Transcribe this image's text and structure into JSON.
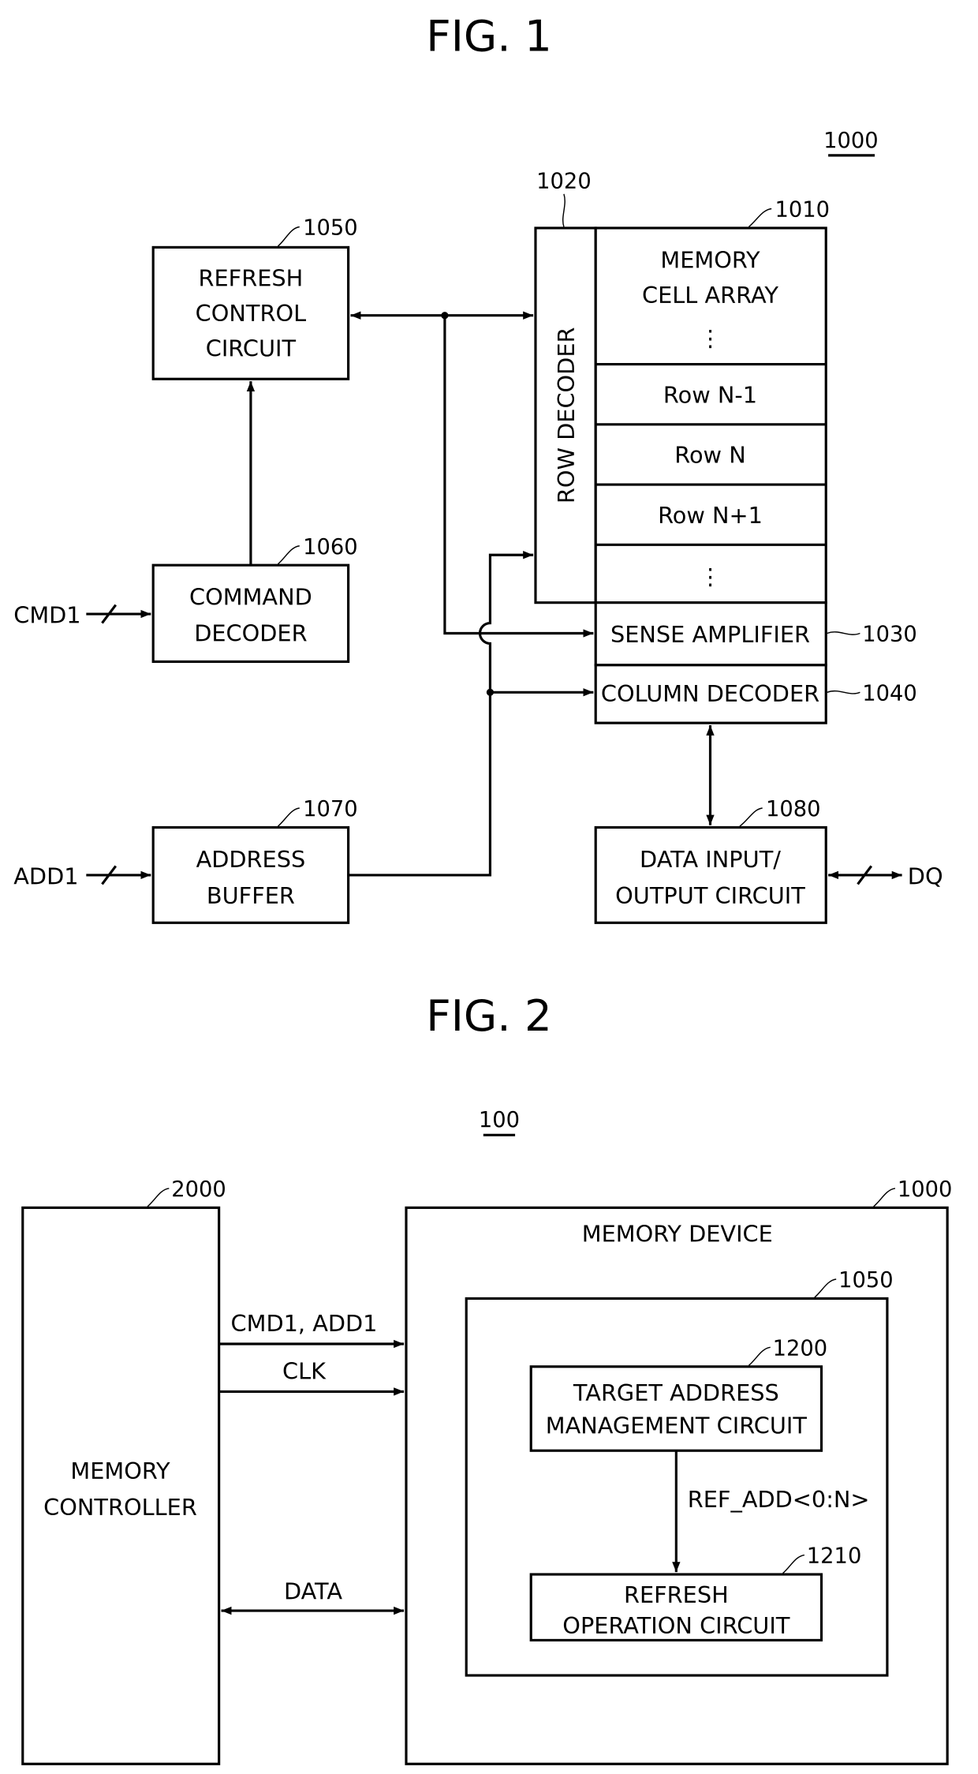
{
  "fig1": {
    "title": "FIG. 1",
    "device_ref": "1000",
    "blocks": {
      "refresh_control": {
        "lines": [
          "REFRESH",
          "CONTROL",
          "CIRCUIT"
        ],
        "ref": "1050"
      },
      "command_decoder": {
        "lines": [
          "COMMAND",
          "DECODER"
        ],
        "ref": "1060"
      },
      "address_buffer": {
        "lines": [
          "ADDRESS",
          "BUFFER"
        ],
        "ref": "1070"
      },
      "row_decoder": {
        "label": "ROW DECODER",
        "ref": "1020"
      },
      "memory_cell_array": {
        "lines": [
          "MEMORY",
          "CELL ARRAY"
        ],
        "ref": "1010",
        "rows": [
          "Row N-1",
          "Row N",
          "Row N+1"
        ],
        "ellipsis": "⋮"
      },
      "sense_amplifier": {
        "label": "SENSE AMPLIFIER",
        "ref": "1030"
      },
      "column_decoder": {
        "label": "COLUMN DECODER",
        "ref": "1040"
      },
      "data_io": {
        "lines": [
          "DATA INPUT/",
          "OUTPUT CIRCUIT"
        ],
        "ref": "1080"
      }
    },
    "signals": {
      "cmd": "CMD1",
      "add": "ADD1",
      "dq": "DQ"
    }
  },
  "fig2": {
    "title": "FIG. 2",
    "system_ref": "100",
    "blocks": {
      "memory_controller": {
        "lines": [
          "MEMORY",
          "CONTROLLER"
        ],
        "ref": "2000"
      },
      "memory_device": {
        "label": "MEMORY DEVICE",
        "ref": "1000"
      },
      "refresh_control": {
        "ref": "1050"
      },
      "target_address_mgmt": {
        "lines": [
          "TARGET ADDRESS",
          "MANAGEMENT CIRCUIT"
        ],
        "ref": "1200"
      },
      "refresh_operation": {
        "lines": [
          "REFRESH",
          "OPERATION CIRCUIT"
        ],
        "ref": "1210"
      }
    },
    "signals": {
      "cmd_add": "CMD1, ADD1",
      "clk": "CLK",
      "data": "DATA",
      "ref_add": "REF_ADD<0:N>"
    }
  }
}
